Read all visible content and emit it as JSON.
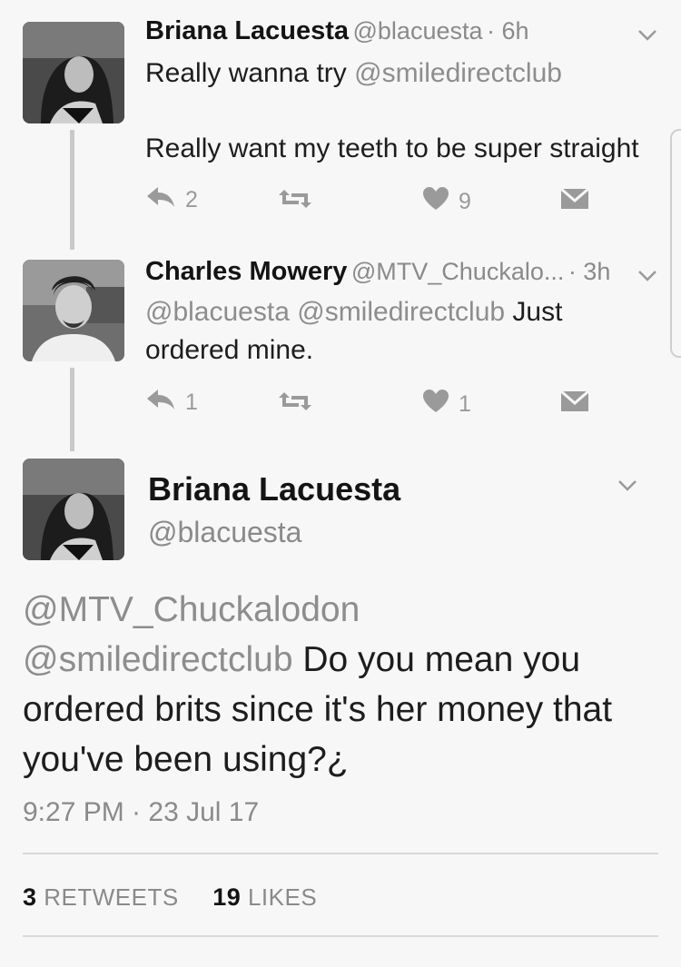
{
  "tweets": [
    {
      "name": "Briana Lacuesta",
      "handle": "@blacuesta",
      "time": "· 6h",
      "line1_prefix": "Really wanna try ",
      "line1_mention": "@smiledirectclub",
      "line2": "Really want my teeth to be super straight",
      "replies": "2",
      "retweets": "",
      "likes": "9"
    },
    {
      "name": "Charles Mowery",
      "handle": "@MTV_Chuckalo...",
      "time": "· 3h",
      "mention1": "@blacuesta",
      "mention2": "@smiledirectclub",
      "text_a": " Just",
      "text_b": "ordered mine.",
      "replies": "1",
      "retweets": "",
      "likes": "1"
    }
  ],
  "main": {
    "name": "Briana Lacuesta",
    "handle": "@blacuesta",
    "mention1": "@MTV_Chuckalodon",
    "mention2": "@smiledirectclub",
    "text_line2": " Do you mean you",
    "text_line3": "ordered brits since it's her money that",
    "text_line4": "you've been using?¿",
    "timestamp": "9:27 PM · 23 Jul 17",
    "retweets_count": "3",
    "retweets_label": "RETWEETS",
    "likes_count": "19",
    "likes_label": "LIKES"
  },
  "icons": {
    "reply": "reply-icon",
    "retweet": "retweet-icon",
    "like": "heart-icon",
    "dm": "envelope-icon",
    "menu": "chevron-down-icon"
  }
}
